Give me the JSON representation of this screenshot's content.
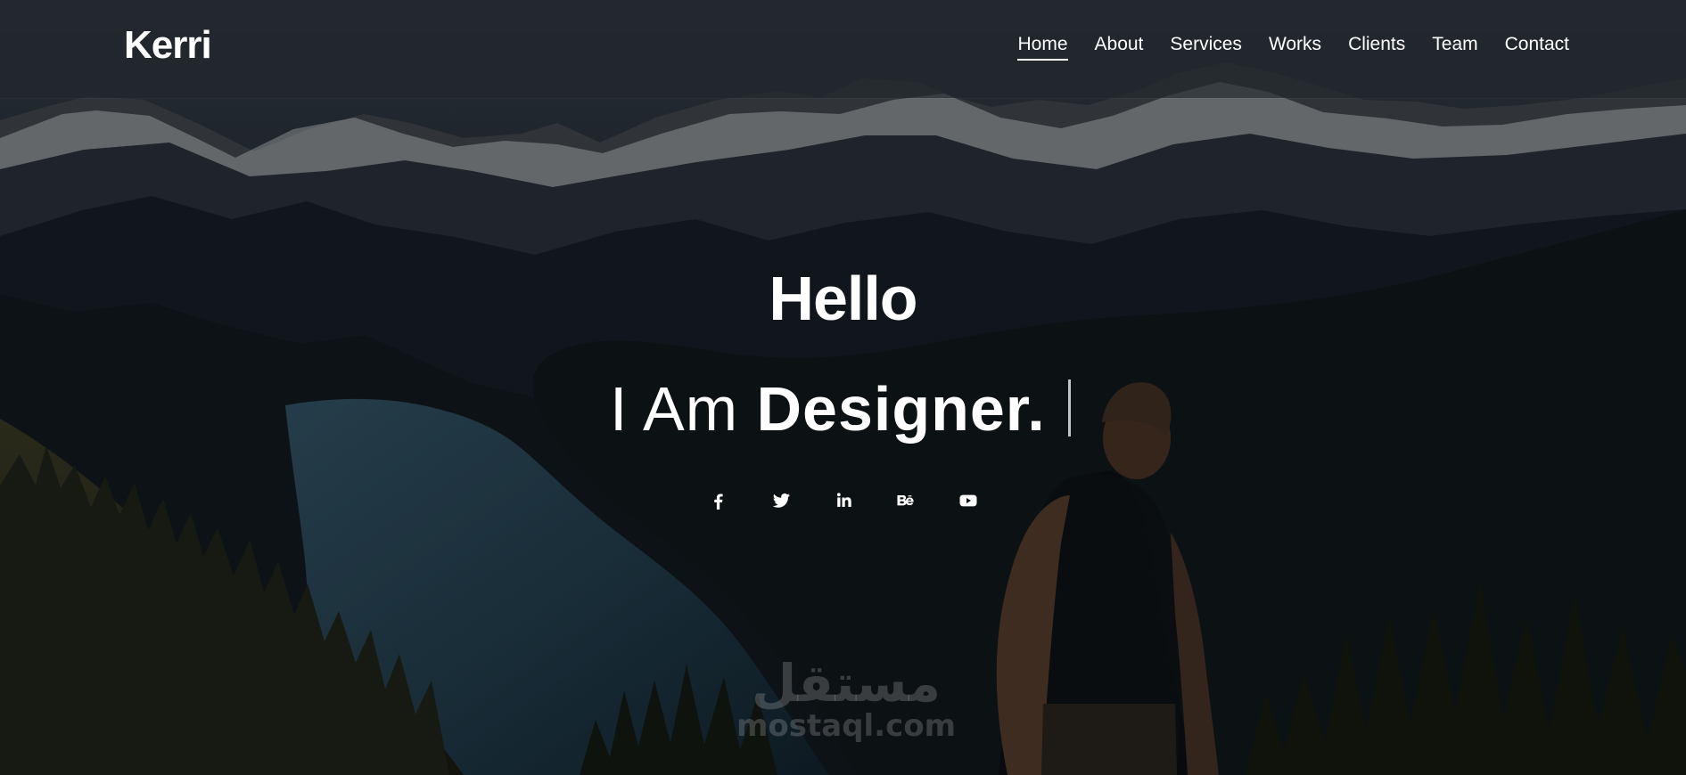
{
  "site": {
    "logo": "Kerri"
  },
  "nav": {
    "items": [
      {
        "label": "Home"
      },
      {
        "label": "About"
      },
      {
        "label": "Services"
      },
      {
        "label": "Works"
      },
      {
        "label": "Clients"
      },
      {
        "label": "Team"
      },
      {
        "label": "Contact"
      }
    ],
    "active": "Home"
  },
  "hero": {
    "greeting": "Hello",
    "prefix": "I Am",
    "role": "Designer."
  },
  "socials": [
    {
      "icon": "facebook-icon"
    },
    {
      "icon": "twitter-icon"
    },
    {
      "icon": "linkedin-icon"
    },
    {
      "icon": "behance-icon"
    },
    {
      "icon": "youtube-icon"
    }
  ],
  "watermark": {
    "arabic": "مستقل",
    "latin": "mostaql.com"
  },
  "colors": {
    "text": "#ffffff",
    "navbar": "#22272c",
    "background": "#0b1015"
  }
}
